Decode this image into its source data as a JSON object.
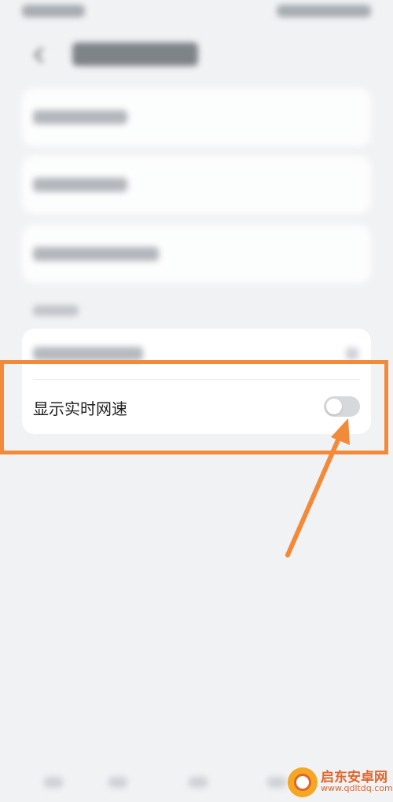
{
  "settings": {
    "realtime_speed_label": "显示实时网速",
    "realtime_speed_enabled": false
  },
  "watermark": {
    "cn_text": "启东安卓网",
    "url_text": "www.qdltdq.com"
  },
  "colors": {
    "highlight": "#f28a3a",
    "background": "#f1f2f4",
    "card": "#ffffff",
    "toggle_off": "#d7d8db"
  }
}
